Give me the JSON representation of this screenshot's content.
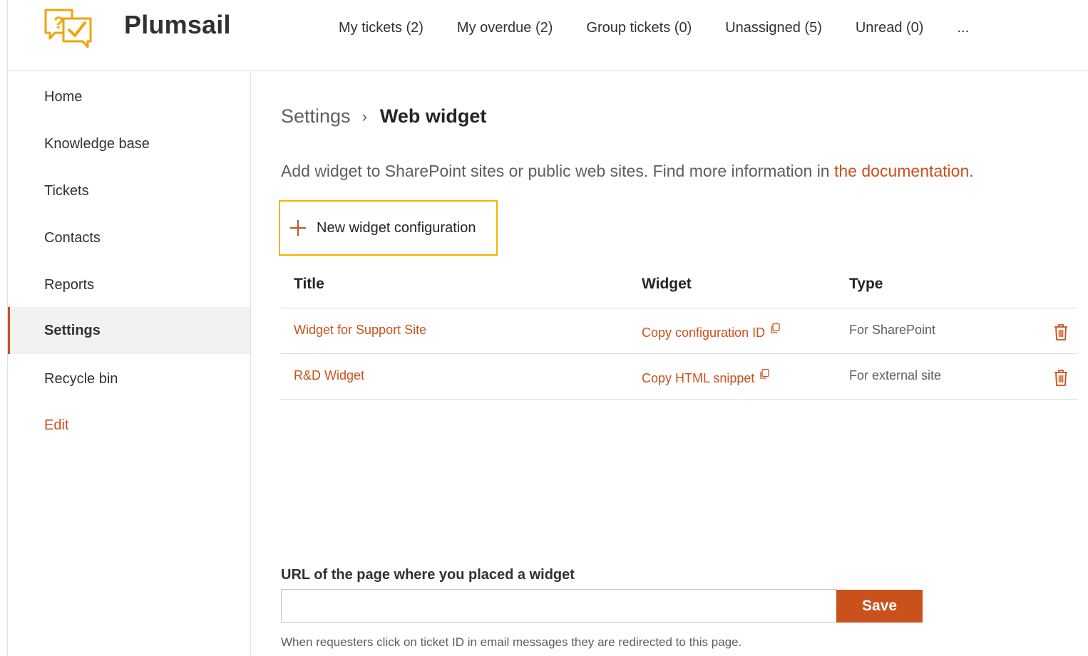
{
  "header": {
    "brand": "Plumsail",
    "nav": [
      {
        "label": "My tickets (2)"
      },
      {
        "label": "My overdue (2)"
      },
      {
        "label": "Group tickets (0)"
      },
      {
        "label": "Unassigned (5)"
      },
      {
        "label": "Unread (0)"
      }
    ],
    "more_label": "..."
  },
  "sidebar": {
    "items": [
      {
        "label": "Home"
      },
      {
        "label": "Knowledge base"
      },
      {
        "label": "Tickets"
      },
      {
        "label": "Contacts"
      },
      {
        "label": "Reports"
      },
      {
        "label": "Settings",
        "active": true
      },
      {
        "label": "Recycle bin"
      }
    ],
    "edit_label": "Edit"
  },
  "main": {
    "breadcrumb": {
      "root": "Settings",
      "separator": "›",
      "current": "Web widget"
    },
    "description": "Add widget to SharePoint sites or public web sites. Find more information in ",
    "description_link": "the documentation",
    "description_end": ".",
    "new_button_label": "New widget configuration",
    "table": {
      "columns": [
        "Title",
        "Widget",
        "Type"
      ],
      "rows": [
        {
          "title": "Widget for Support Site",
          "widget": "Copy configuration ID",
          "type": "For SharePoint"
        },
        {
          "title": "R&D Widget",
          "widget": "Copy HTML snippet",
          "type": "For external site"
        }
      ]
    },
    "url_label": "URL of the page where you placed a widget",
    "url_value": "",
    "url_placeholder": "",
    "save_label": "Save",
    "hint": "When requesters click on ticket ID in email messages they are redirected to this page."
  },
  "colors": {
    "accent": "#c9511c",
    "logo": "#f0a30a",
    "highlight_border": "#f0b400"
  }
}
